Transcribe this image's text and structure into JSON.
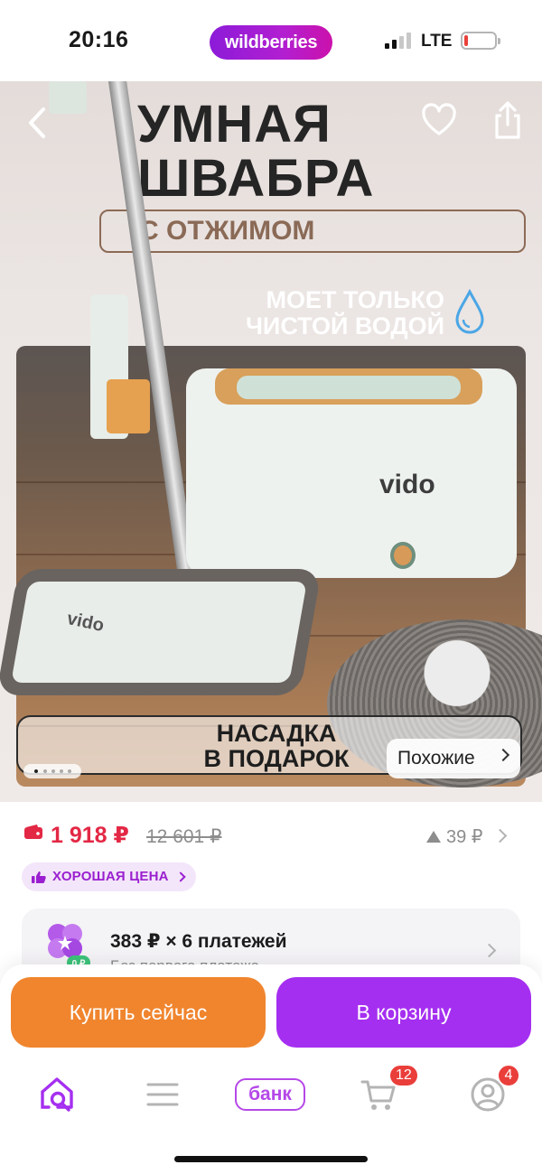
{
  "status_bar": {
    "time": "20:16",
    "brand": "wildberries",
    "network": "LTE"
  },
  "hero": {
    "title_line1": "УМНАЯ",
    "title_line2": "ШВАБРА",
    "subtitle": "С ОТЖИМОМ",
    "water_line1": "МОЕТ ТОЛЬКО",
    "water_line2": "ЧИСТОЙ ВОДОЙ",
    "bucket_brand": "vido",
    "mop_brand": "vido",
    "promo_line1": "НАСАДКА",
    "promo_line2": "В ПОДАРОК",
    "similar_label": "Похожие",
    "slide_index": 1,
    "slide_count": 5
  },
  "price": {
    "current": "1 918 ₽",
    "old": "12 601 ₽",
    "delta": "39 ₽",
    "badge": "ХОРОШАЯ ЦЕНА",
    "accent_color": "#e32845"
  },
  "installment": {
    "title": "383 ₽ × 6 платежей",
    "subtitle": "Без первого платежа",
    "icon_badge": "0 ₽"
  },
  "actions": {
    "buy_now": "Купить сейчас",
    "add_to_cart": "В корзину",
    "buy_color": "#f0852e",
    "cart_color": "#a52ff0"
  },
  "tabbar": {
    "bank_label": "банк",
    "cart_badge": "12",
    "profile_badge": "4"
  }
}
